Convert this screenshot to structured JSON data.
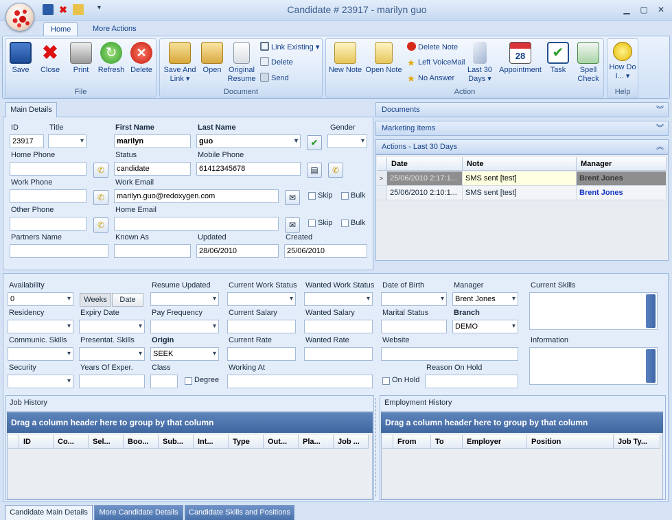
{
  "window": {
    "title": "Candidate # 23917 - marilyn guo",
    "min": "▁",
    "max": "▢",
    "close": "✕"
  },
  "ribbon_tabs": [
    "Home",
    "More Actions"
  ],
  "file_group": {
    "label": "File",
    "buttons": [
      "Save",
      "Close",
      "Print",
      "Refresh",
      "Delete"
    ]
  },
  "document_group": {
    "label": "Document",
    "save_and_link": "Save And Link",
    "open": "Open",
    "original_resume": "Original Resume",
    "link_existing": "Link Existing",
    "delete": "Delete",
    "send": "Send"
  },
  "action_group": {
    "label": "Action",
    "new_note": "New Note",
    "open_note": "Open Note",
    "delete_note": "Delete Note",
    "left_voicemail": "Left VoiceMail",
    "no_answer": "No Answer",
    "last30": "Last 30 Days",
    "appointment": "Appointment",
    "task": "Task",
    "spell_check": "Spell Check"
  },
  "help_group": {
    "label": "Help",
    "how_do_i": "How Do I..."
  },
  "main_details": {
    "tab": "Main Details",
    "labels": {
      "id": "ID",
      "title": "Title",
      "first_name": "First Name",
      "last_name": "Last Name",
      "gender": "Gender",
      "home_phone": "Home Phone",
      "status": "Status",
      "mobile_phone": "Mobile Phone",
      "work_phone": "Work Phone",
      "work_email": "Work Email",
      "other_phone": "Other Phone",
      "home_email": "Home Email",
      "partners_name": "Partners Name",
      "known_as": "Known As",
      "updated": "Updated",
      "created": "Created",
      "skip": "Skip",
      "bulk": "Bulk"
    },
    "values": {
      "id": "23917",
      "title": "",
      "first_name": "marilyn",
      "last_name": "guo",
      "gender": "",
      "home_phone": "",
      "status": "candidate",
      "mobile_phone": "61412345678",
      "work_phone": "",
      "work_email": "marilyn.guo@redoxygen.com",
      "other_phone": "",
      "home_email": "",
      "partners_name": "",
      "known_as": "",
      "updated": "28/06/2010",
      "created": "25/06/2010"
    }
  },
  "side_panels": {
    "documents": "Documents",
    "marketing": "Marketing Items",
    "actions": "Actions - Last 30 Days"
  },
  "actions_grid": {
    "columns": [
      "Date",
      "Note",
      "Manager"
    ],
    "rows": [
      {
        "date": "25/06/2010 2:17:1...",
        "note": "SMS sent [test]",
        "manager": "Brent Jones"
      },
      {
        "date": "25/06/2010 2:10:1...",
        "note": "SMS sent [test]",
        "manager": "Brent Jones"
      }
    ]
  },
  "details": {
    "labels": {
      "availability": "Availability",
      "resume_updated": "Resume Updated",
      "current_work_status": "Current Work Status",
      "wanted_work_status": "Wanted Work Status",
      "date_of_birth": "Date of Birth",
      "manager": "Manager",
      "current_skills": "Current Skills",
      "residency": "Residency",
      "expiry_date": "Expiry Date",
      "pay_frequency": "Pay Frequency",
      "current_salary": "Current Salary",
      "wanted_salary": "Wanted Salary",
      "marital_status": "Marital Status",
      "branch": "Branch",
      "communic_skills": "Communic. Skills",
      "presentat_skills": "Presentat. Skills",
      "origin": "Origin",
      "current_rate": "Current Rate",
      "wanted_rate": "Wanted Rate",
      "website": "Website",
      "information": "Information",
      "security": "Security",
      "years_exper": "Years Of Exper.",
      "class": "Class",
      "degree": "Degree",
      "working_at": "Working At",
      "on_hold": "On Hold",
      "reason_on_hold": "Reason On Hold"
    },
    "values": {
      "availability": "0",
      "manager": "Brent Jones",
      "branch": "DEMO",
      "origin": "SEEK"
    },
    "weeks": "Weeks",
    "date": "Date"
  },
  "job_history": {
    "title": "Job History",
    "group_hint": "Drag a column header here to group by that column",
    "columns": [
      "ID",
      "Co...",
      "Sel...",
      "Boo...",
      "Sub...",
      "Int...",
      "Type",
      "Out...",
      "Pla...",
      "Job ..."
    ]
  },
  "employment_history": {
    "title": "Employment History",
    "group_hint": "Drag a column header here to group by that column",
    "columns": [
      "From",
      "To",
      "Employer",
      "Position",
      "Job Ty..."
    ]
  },
  "bottom_tabs": [
    "Candidate Main Details",
    "More Candidate Details",
    "Candidate Skills and Positions"
  ],
  "colors": {
    "ribbon_blue": "#15428b",
    "group_panel": "#4a72ab",
    "selected_row": "#8e8e8e"
  }
}
